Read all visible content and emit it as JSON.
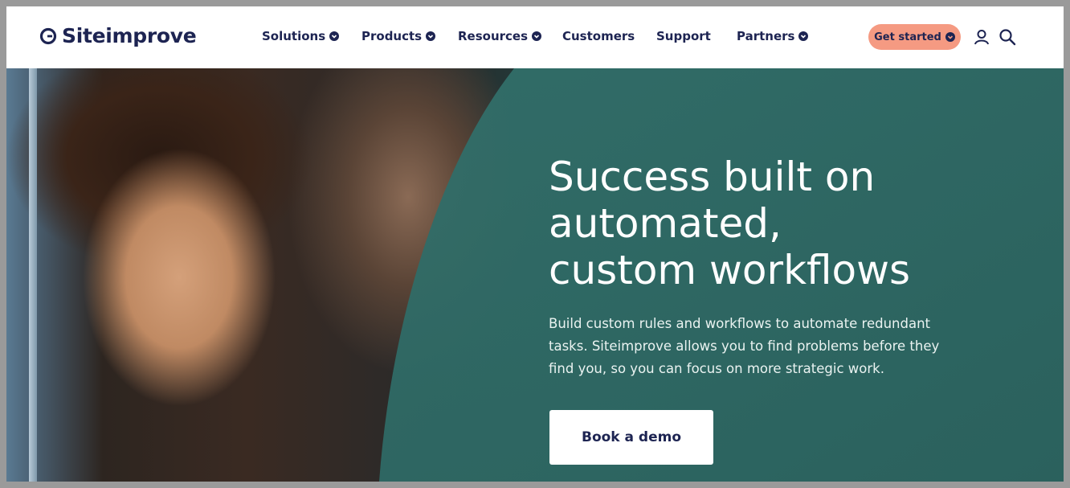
{
  "brand": {
    "name": "Siteimprove",
    "colors": {
      "navy": "#1d2452",
      "accent": "#f59a82",
      "teal": "#2f6b66"
    }
  },
  "nav": {
    "items": [
      {
        "label": "Solutions",
        "has_dropdown": true
      },
      {
        "label": "Products",
        "has_dropdown": true
      },
      {
        "label": "Resources",
        "has_dropdown": true
      },
      {
        "label": "Customers",
        "has_dropdown": false
      },
      {
        "label": "Support",
        "has_dropdown": false
      },
      {
        "label": "Partners",
        "has_dropdown": true
      }
    ],
    "cta_label": "Get started",
    "icons": [
      "user-icon",
      "search-icon"
    ]
  },
  "hero": {
    "title_lines": [
      "Success built on",
      "automated,",
      "custom workflows"
    ],
    "description_lines": [
      "Build custom rules and workflows to automate redundant",
      "tasks. Siteimprove allows you to find problems before they",
      "find you, so you can focus on more strategic work."
    ],
    "button_label": "Book a demo"
  }
}
